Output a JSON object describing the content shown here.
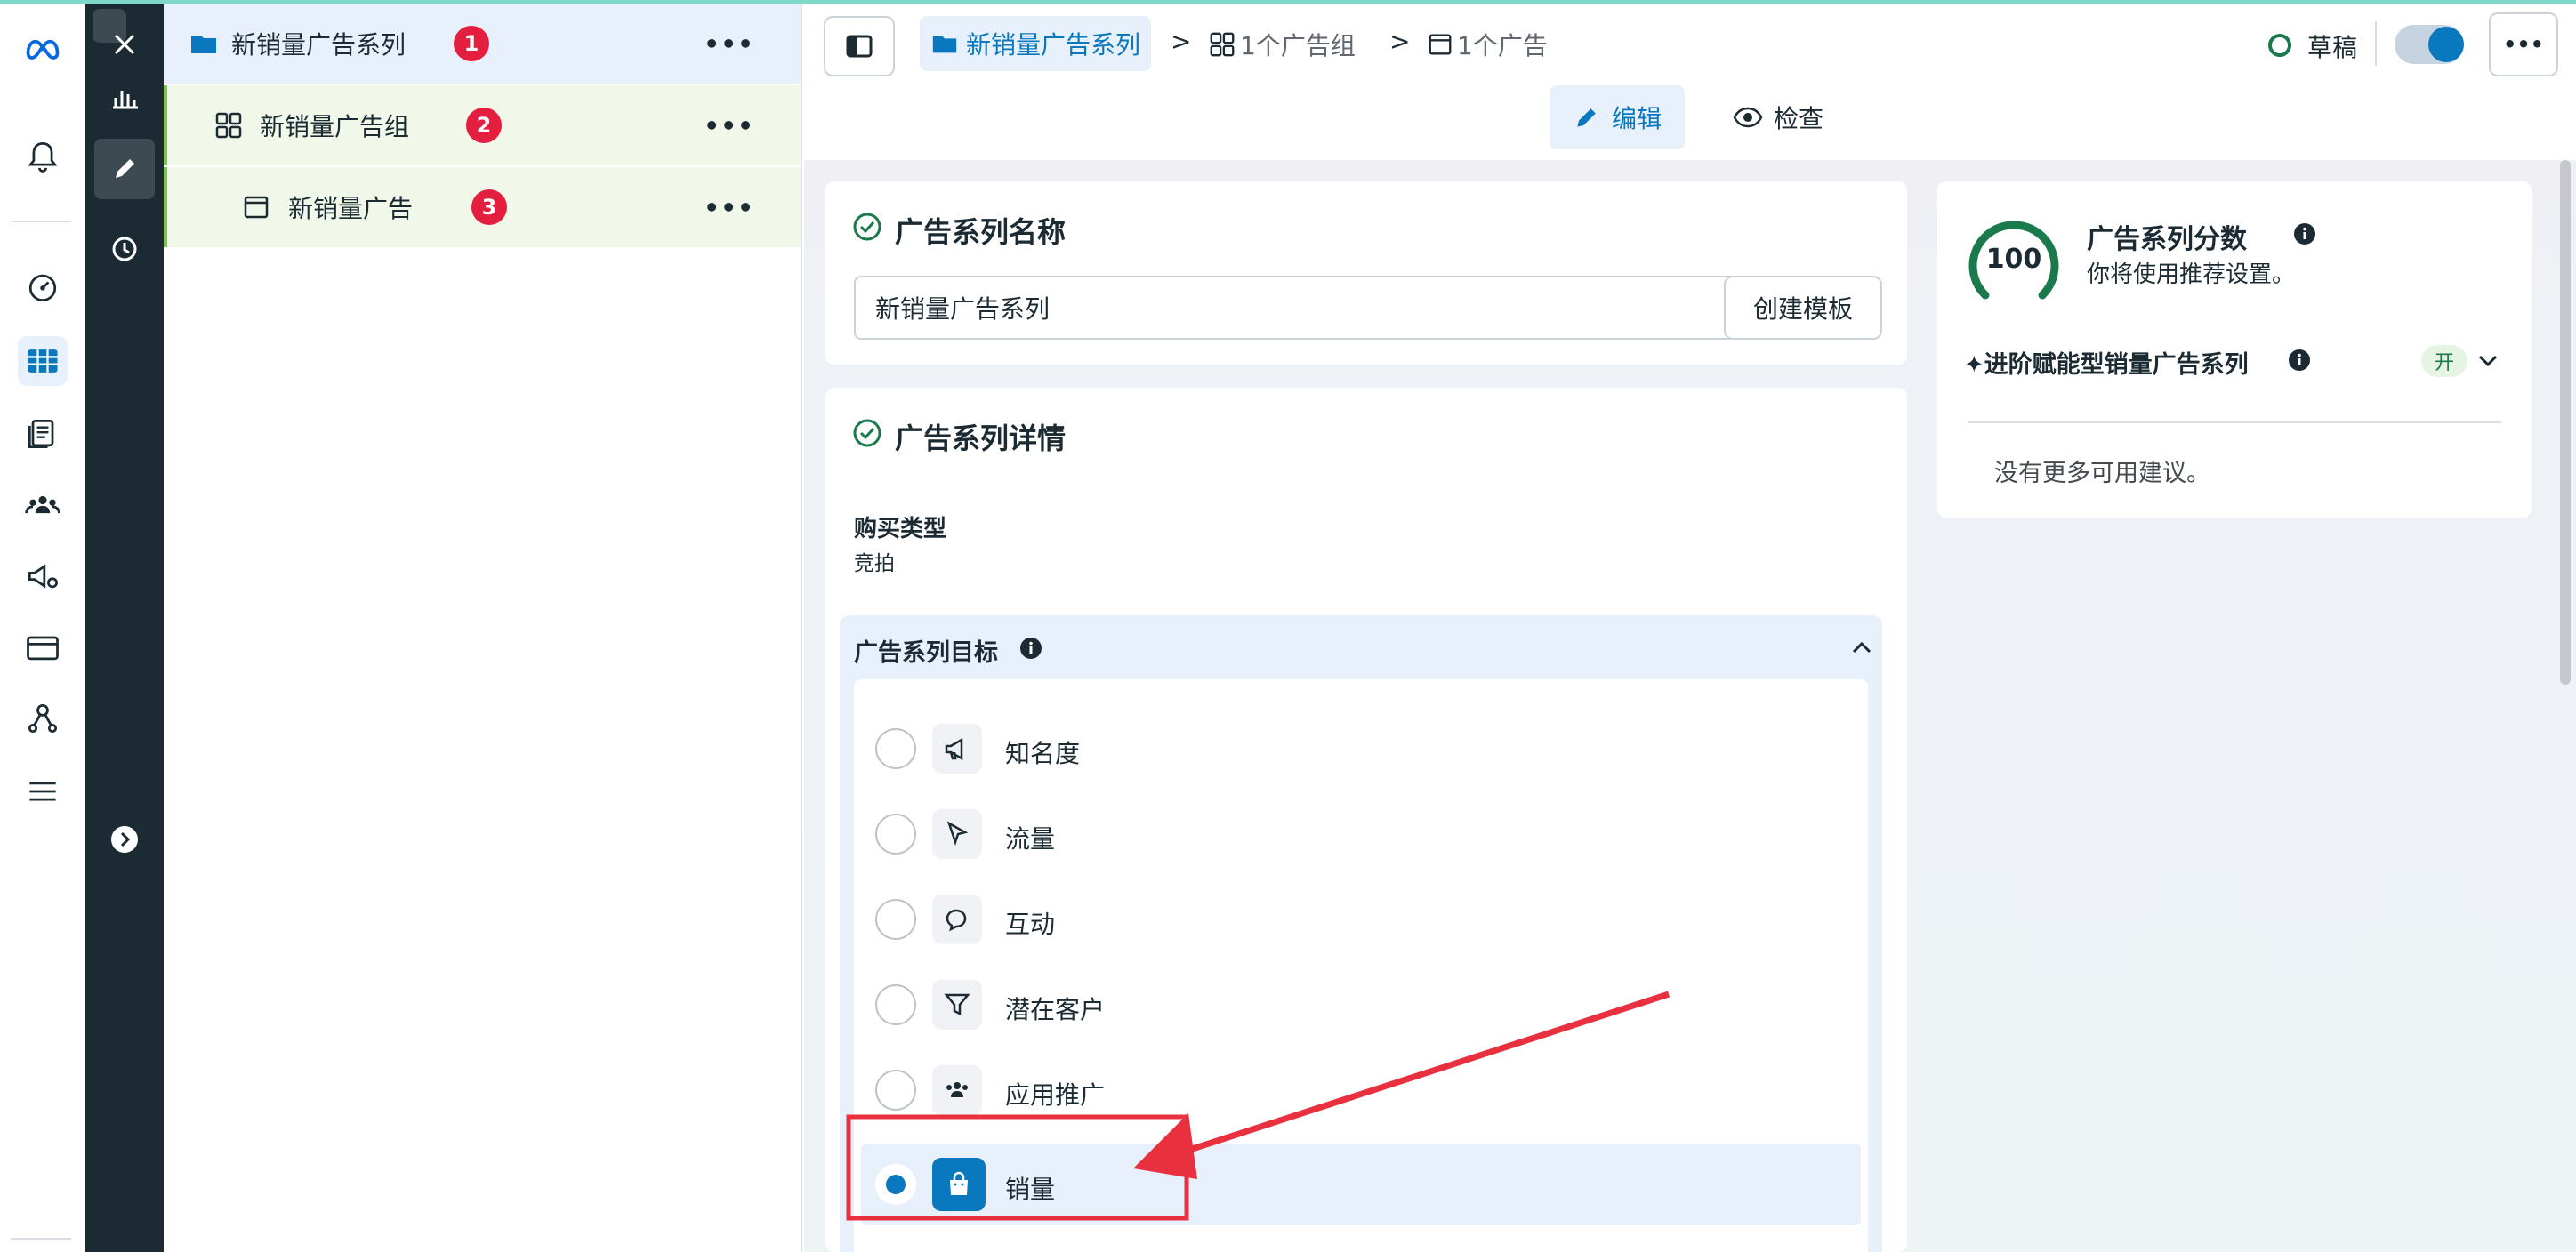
{
  "colors": {
    "accent": "#0a78be",
    "annotation": "#e8303f",
    "tree_highlight": "#e7f0fb",
    "tree_sub": "#f1f8ea",
    "dark_bar": "#1c2b33"
  },
  "icons": {
    "rail": [
      "meta-logo-icon",
      "bell-icon",
      "dashboard-icon",
      "table-icon",
      "documents-icon",
      "audience-icon",
      "megaphone-gear-icon",
      "card-icon",
      "network-icon",
      "menu-icon"
    ],
    "dark_bar": [
      "close-icon",
      "bar-chart-icon",
      "pencil-icon",
      "clock-icon",
      "chevron-right-icon"
    ]
  },
  "tree": {
    "items": [
      {
        "label": "新销量广告系列",
        "badge": "1",
        "icon": "folder-icon"
      },
      {
        "label": "新销量广告组",
        "badge": "2",
        "icon": "grid-icon"
      },
      {
        "label": "新销量广告",
        "badge": "3",
        "icon": "window-icon"
      }
    ],
    "more": "•••"
  },
  "header": {
    "breadcrumb": {
      "campaign": "新销量广告系列",
      "sep": ">",
      "adset": "1个广告组",
      "ad": "1个广告"
    },
    "status": "草稿",
    "more": "•••",
    "tabs": {
      "edit": "编辑",
      "review": "检查"
    }
  },
  "name_card": {
    "title": "广告系列名称",
    "value": "新销量广告系列",
    "template_button": "创建模板"
  },
  "details_card": {
    "title": "广告系列详情",
    "buy_type_label": "购买类型",
    "buy_type_value": "竞拍",
    "objective_title": "广告系列目标",
    "objectives": [
      {
        "label": "知名度",
        "icon": "megaphone-icon",
        "selected": false
      },
      {
        "label": "流量",
        "icon": "cursor-icon",
        "selected": false
      },
      {
        "label": "互动",
        "icon": "chat-icon",
        "selected": false
      },
      {
        "label": "潜在客户",
        "icon": "funnel-icon",
        "selected": false
      },
      {
        "label": "应用推广",
        "icon": "people-icon",
        "selected": false
      },
      {
        "label": "销量",
        "icon": "shopping-bag-icon",
        "selected": true
      }
    ]
  },
  "score_card": {
    "score": "100",
    "score_value": 100,
    "title": "广告系列分数",
    "subtitle": "你将使用推荐设置。",
    "advantage_label": "✦进阶赋能型销量广告系列",
    "advantage_state": "开",
    "empty_note": "没有更多可用建议。"
  }
}
